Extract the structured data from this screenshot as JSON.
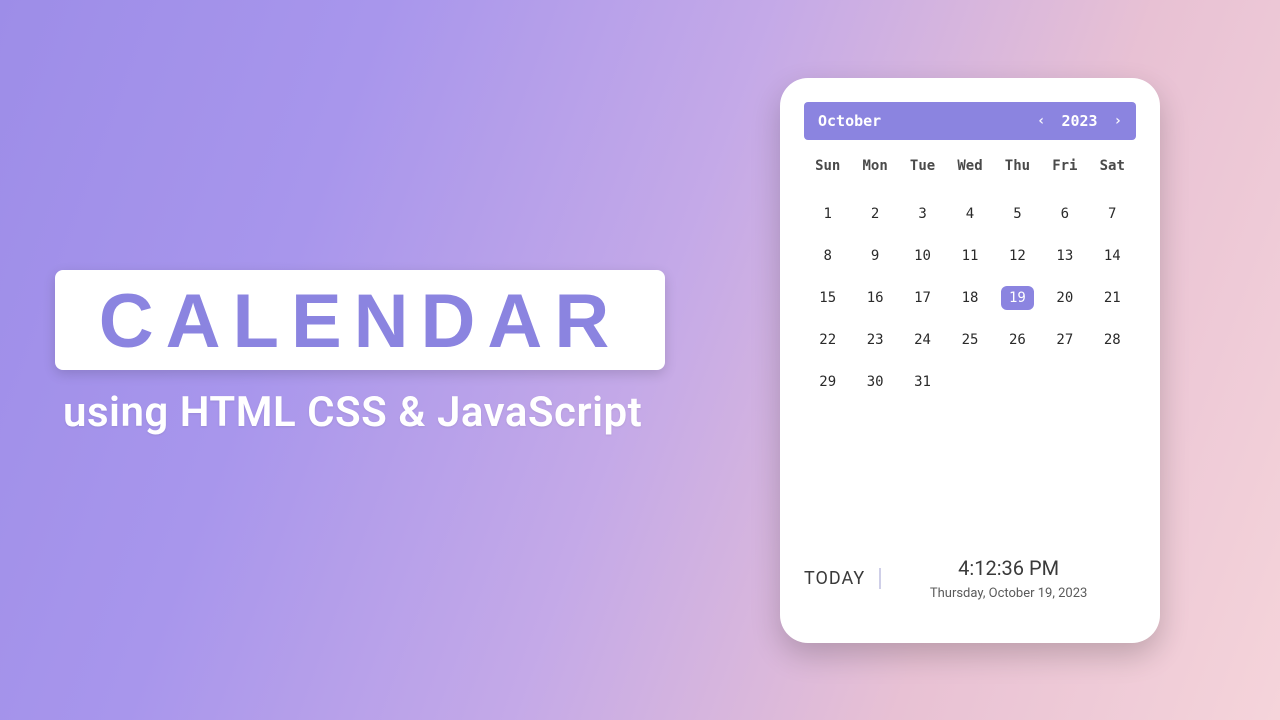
{
  "hero": {
    "title": "CALENDAR",
    "subtitle": "using HTML CSS & JavaScript"
  },
  "calendar": {
    "month": "October",
    "year": "2023",
    "prev_icon": "‹",
    "next_icon": "›",
    "weekdays": [
      "Sun",
      "Mon",
      "Tue",
      "Wed",
      "Thu",
      "Fri",
      "Sat"
    ],
    "days": [
      1,
      2,
      3,
      4,
      5,
      6,
      7,
      8,
      9,
      10,
      11,
      12,
      13,
      14,
      15,
      16,
      17,
      18,
      19,
      20,
      21,
      22,
      23,
      24,
      25,
      26,
      27,
      28,
      29,
      30,
      31
    ],
    "selected_day": 19
  },
  "today": {
    "label": "TODAY",
    "time": "4:12:36 PM",
    "date": "Thursday, October 19, 2023"
  }
}
